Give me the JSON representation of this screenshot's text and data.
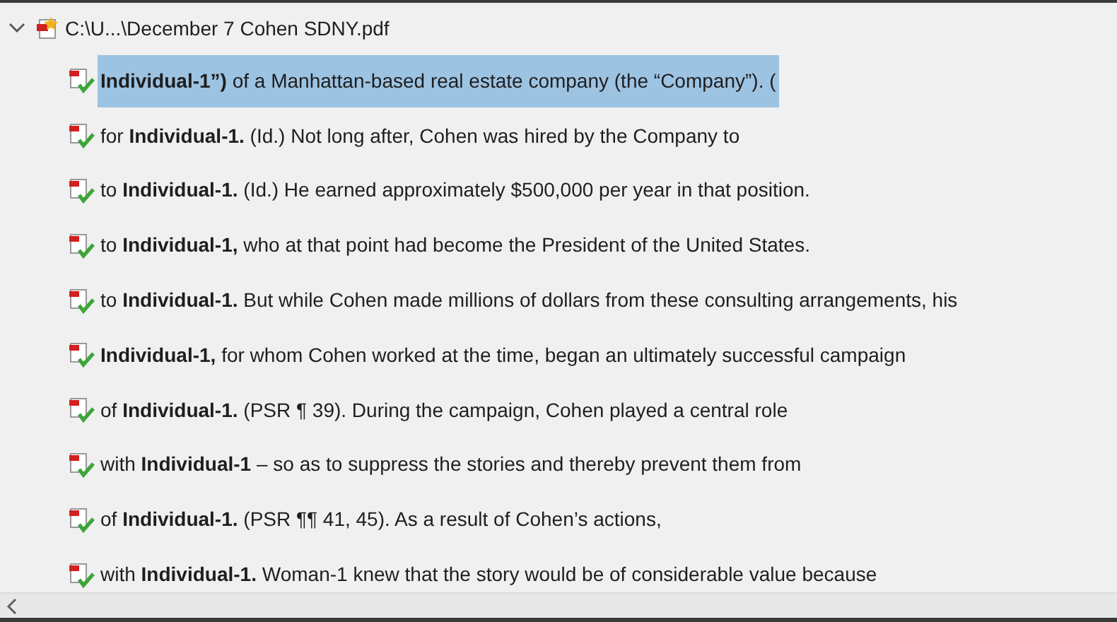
{
  "root": {
    "path": "C:\\U...\\December 7 Cohen SDNY.pdf",
    "expanded": true
  },
  "hits": [
    {
      "text": "**Individual-1”)** of a Manhattan-based real estate company (the “Company”). (",
      "selected": true
    },
    {
      "text": "for **Individual-1.** (Id.) Not long after, Cohen was hired by the Company to",
      "selected": false
    },
    {
      "text": "to **Individual-1.** (Id.) He earned approximately $500,000 per year in that position.",
      "selected": false
    },
    {
      "text": "to **Individual-1,** who at that point had become the President of the United States.",
      "selected": false
    },
    {
      "text": "to **Individual-1.** But while Cohen made millions of dollars from these consulting arrangements, his",
      "selected": false
    },
    {
      "text": "**Individual-1,** for whom Cohen worked at the time, began an ultimately successful campaign",
      "selected": false
    },
    {
      "text": "of **Individual-1.** (PSR ¶ 39). During the campaign, Cohen played a central role",
      "selected": false
    },
    {
      "text": "with **Individual-1** – so as to suppress the stories and thereby prevent them from",
      "selected": false
    },
    {
      "text": "of **Individual-1.** (PSR ¶¶ 41, 45). As a result of Cohen’s actions,",
      "selected": false
    },
    {
      "text": "with **Individual-1.** Woman-1 knew that the story would be of considerable value because",
      "selected": false
    }
  ]
}
